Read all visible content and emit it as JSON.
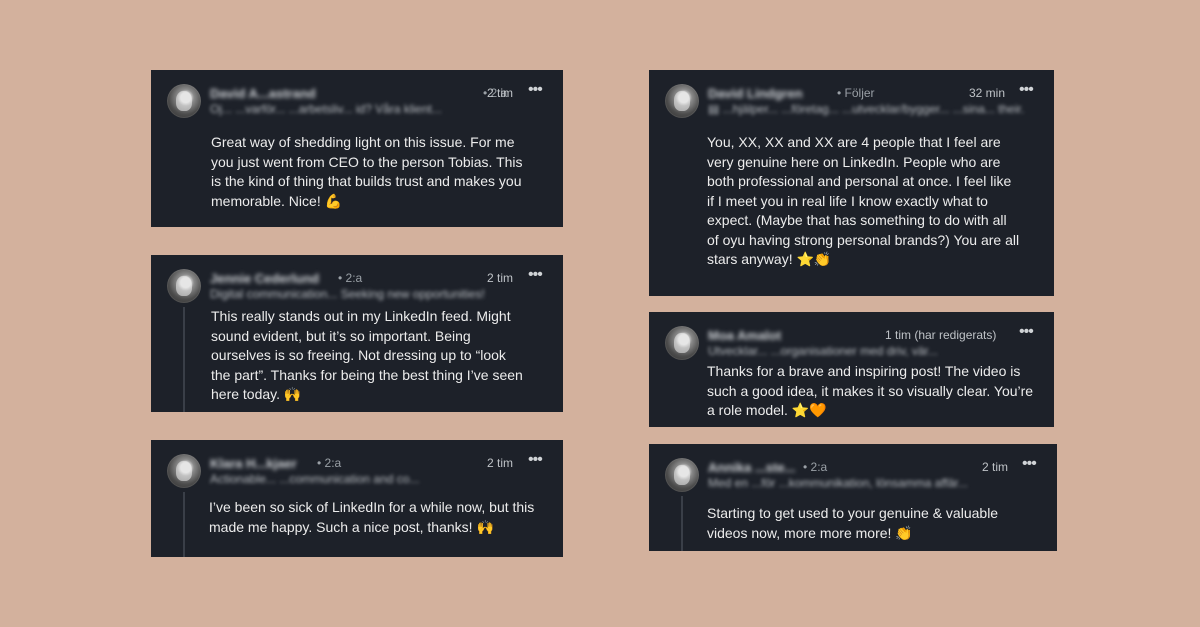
{
  "cards": [
    {
      "name": "David A...astrand",
      "degree": "• 2:a",
      "headline": "Oj... ...varför... ...arbetsliv... id? Våra klient...",
      "time": "2 tim",
      "more_icon": "•••",
      "text": "Great way of shedding light on this issue. For me you just went from CEO to the person Tobias. This is the kind of thing that builds trust and makes you memorable. Nice!",
      "emoji": "💪"
    },
    {
      "name": "Jennie Cederlund",
      "degree": "• 2:a",
      "headline": "Digital communication... Seeking new opportunities!",
      "time": "2 tim",
      "more_icon": "•••",
      "text": "This really stands out in my LinkedIn feed. Might sound evident, but it’s so important. Being ourselves is so freeing. Not dressing up to “look the part”. Thanks for being the best thing I’ve seen here today.",
      "emoji": "🙌"
    },
    {
      "name": "Klara H...kjaer",
      "degree": "• 2:a",
      "headline": "Actionable... ...communication and co...",
      "time": "2 tim",
      "more_icon": "•••",
      "text": "I’ve been so sick of LinkedIn for a while now, but this made me happy. Such a nice post, thanks!",
      "emoji": "🙌"
    },
    {
      "name": "David Lindgren",
      "degree": "• Följer",
      "headline": "▤ ...hjälper... ...företag... ...utvecklar/bygger... ...sina... their...",
      "time": "32 min",
      "more_icon": "•••",
      "text": "You, XX, XX and XX are 4 people that I feel are very genuine here on LinkedIn. People who are both professional and personal at once. I feel like if I meet you in real life I know exactly what to expect. (Maybe that has something to do with all of oyu having strong personal brands?) You are all stars anyway!",
      "emoji": "⭐👏"
    },
    {
      "name": "Moa Amalot",
      "degree": "",
      "headline": "Utvecklar... ...organisationer med driv, vär...",
      "time": "1 tim (har redigerats)",
      "more_icon": "•••",
      "text": "Thanks for a brave and inspiring post! The video is such a good idea, it makes it so visually clear. You’re a role model.",
      "emoji": "⭐🧡"
    },
    {
      "name": "Annika ...ste...",
      "degree": "• 2:a",
      "headline": "Med en ...för ...kommunikation, lönsamma affär...",
      "time": "2 tim",
      "more_icon": "•••",
      "text": "Starting to get used to your genuine & valuable videos now, more more more!",
      "emoji": "👏"
    }
  ],
  "colors": {
    "background": "#d3b19d",
    "card": "#1d2129",
    "text": "#ececec",
    "muted": "#9aa0a6"
  }
}
